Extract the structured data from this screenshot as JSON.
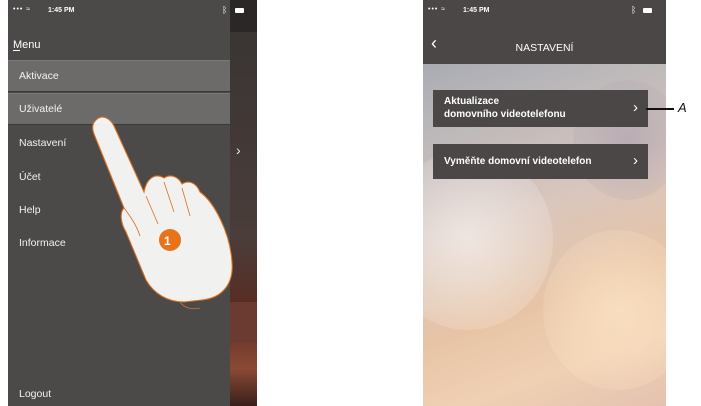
{
  "left_phone": {
    "status": {
      "signal": "••• ",
      "time": "1:45 PM"
    },
    "menu_title": "Menu",
    "menu_items": [
      {
        "label": "Aktivace",
        "highlighted": true
      },
      {
        "label": "Uživatelé",
        "highlighted": true
      },
      {
        "label": "Nastavení",
        "highlighted": false
      },
      {
        "label": "Účet",
        "highlighted": false
      },
      {
        "label": "Help",
        "highlighted": false
      },
      {
        "label": "Informace",
        "highlighted": false
      }
    ],
    "logout_label": "Logout",
    "step_badge": "1",
    "colors": {
      "drawer": "#4c4a48",
      "highlight": "#6d6b69",
      "badge": "#e8731a"
    }
  },
  "right_phone": {
    "status": {
      "signal": "••• ",
      "time": "1:45 PM"
    },
    "title": "NASTAVENÍ",
    "buttons": [
      {
        "line1": "Aktualizace",
        "line2": "domovního videotelefonu"
      },
      {
        "line1": "Vyměňte domovní videotelefon",
        "line2": ""
      }
    ],
    "colors": {
      "header": "#4a4746",
      "button": "#4a4746"
    }
  },
  "callout_label": "A"
}
